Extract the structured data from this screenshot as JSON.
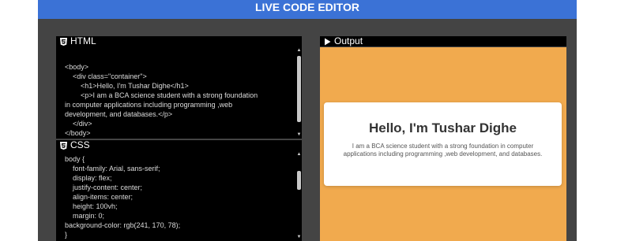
{
  "header": {
    "title": "LIVE CODE EDITOR"
  },
  "html_panel": {
    "title": "HTML",
    "icon": "html5-icon",
    "lines": [
      "<body>",
      "    <div class=\"container\">",
      "        <h1>Hello, I'm Tushar Dighe</h1>",
      "        <p>I am a BCA science student with a strong foundation",
      "in computer applications including programming ,web",
      "development, and databases.</p>",
      "    </div>",
      "</body>"
    ]
  },
  "css_panel": {
    "title": "CSS",
    "icon": "css3-icon",
    "lines": [
      "body {",
      "    font-family: Arial, sans-serif;",
      "    display: flex;",
      "    justify-content: center;",
      "    align-items: center;",
      "    height: 100vh;",
      "    margin: 0;",
      "background-color: rgb(241, 170, 78);",
      "}"
    ]
  },
  "output_panel": {
    "title": "Output",
    "icon": "play-icon",
    "heading": "Hello, I'm Tushar Dighe",
    "paragraph": "I am a BCA science student with a strong foundation in computer applications including programming ,web development, and databases."
  },
  "colors": {
    "header_bg": "#3b72d6",
    "app_bg": "#444444",
    "editor_bg": "#000000",
    "output_bg": "#f1aa4e"
  }
}
